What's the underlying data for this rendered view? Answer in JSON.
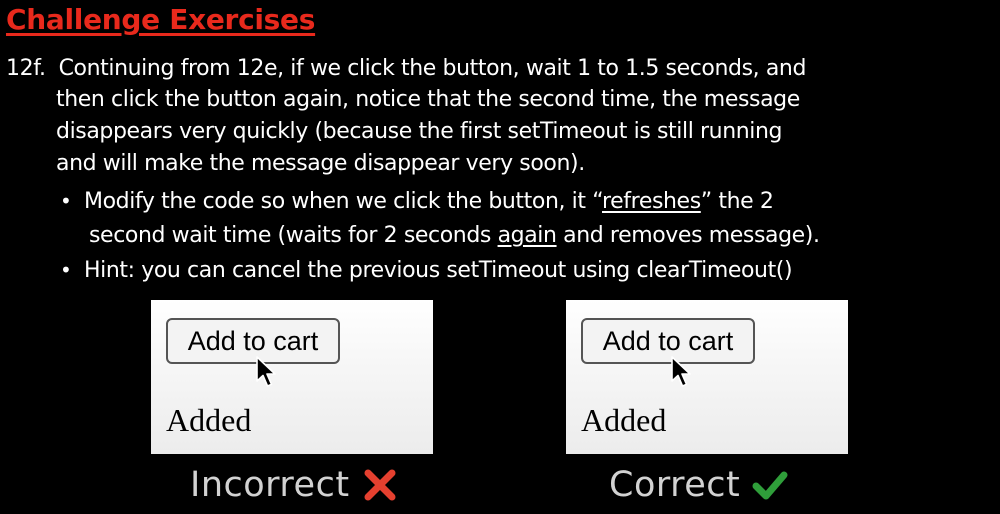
{
  "title": "Challenge Exercises",
  "exercise": {
    "number": "12f.",
    "lines": [
      "Continuing from 12e, if we click the button, wait 1 to 1.5 seconds, and",
      "then click the button again, notice that the second time, the message",
      "disappears very quickly (because the first setTimeout is still running",
      "and will make the message disappear very soon)."
    ],
    "bullets": [
      {
        "dot": "•",
        "line1_pre": "Modify the code so when we click the button, it “",
        "line1_underlined": "refreshes",
        "line1_post": "” the 2",
        "line2_pre": "second wait time (waits for 2 seconds ",
        "line2_underlined": "again",
        "line2_post": " and removes message)."
      },
      {
        "dot": "•",
        "text": "Hint: you can cancel the previous setTimeout using clearTimeout()"
      }
    ]
  },
  "demos": [
    {
      "button_label": "Add to cart",
      "message": "Added",
      "verdict": "Incorrect",
      "verdict_icon": "cross-icon",
      "verdict_color": "#e5402f"
    },
    {
      "button_label": "Add to cart",
      "message": "Added",
      "verdict": "Correct",
      "verdict_icon": "checkmark-icon",
      "verdict_color": "#2f9e3a"
    }
  ],
  "colors": {
    "background": "#000000",
    "title": "#e8291c",
    "text": "#ffffff",
    "verdict_text": "#d2d2d2"
  }
}
